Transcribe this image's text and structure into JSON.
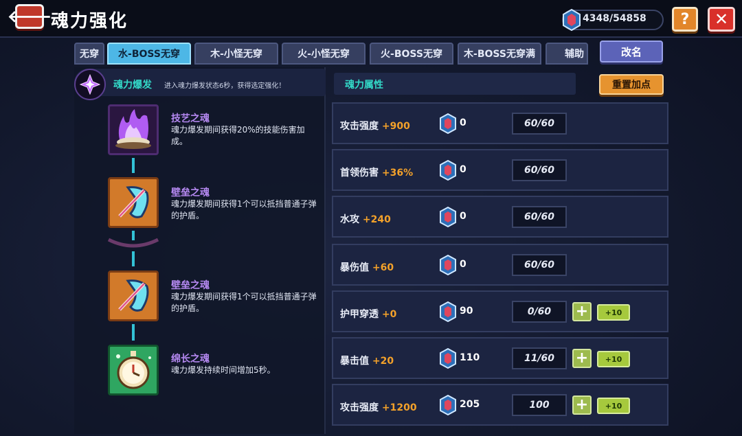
{
  "header": {
    "title": "魂力强化",
    "back_label": "🡐",
    "currency": "4348/54858",
    "help_label": "?",
    "close_label": "✕"
  },
  "tabs": [
    {
      "label": "无穿"
    },
    {
      "label": "水-BOSS无穿",
      "active": true
    },
    {
      "label": "木-小怪无穿"
    },
    {
      "label": "火-小怪无穿"
    },
    {
      "label": "火-BOSS无穿"
    },
    {
      "label": "木-BOSS无穿满"
    },
    {
      "label": "辅助"
    }
  ],
  "rename_label": "改名",
  "burst": {
    "title": "魂力爆发",
    "description": "进入魂力爆发状态6秒，获得选定强化！"
  },
  "souls": [
    {
      "name": "技艺之魂",
      "description": "魂力爆发期间获得20%的技能伤害加成。",
      "icon": "purple-flame-icon"
    },
    {
      "name": "壁垒之魂",
      "description": "魂力爆发期间获得1个可以抵挡普通子弹的护盾。",
      "icon": "shield-icon"
    },
    {
      "name": "壁垒之魂",
      "description": "魂力爆发期间获得1个可以抵挡普通子弹的护盾。",
      "icon": "shield-icon"
    },
    {
      "name": "绵长之魂",
      "description": "魂力爆发持续时间增加5秒。",
      "icon": "stopwatch-icon"
    }
  ],
  "attributes": {
    "title": "魂力属性",
    "reset_label": "重置加点",
    "plus_label": "+",
    "plus10_label": "+10",
    "rows": [
      {
        "label": "攻击强度",
        "bonus": "+900",
        "cost": "0",
        "level": "60/60",
        "can_add": false
      },
      {
        "label": "首领伤害",
        "bonus": "+36%",
        "cost": "0",
        "level": "60/60",
        "can_add": false
      },
      {
        "label": "水攻",
        "bonus": "+240",
        "cost": "0",
        "level": "60/60",
        "can_add": false
      },
      {
        "label": "暴伤值",
        "bonus": "+60",
        "cost": "0",
        "level": "60/60",
        "can_add": false
      },
      {
        "label": "护甲穿透",
        "bonus": "+0",
        "cost": "90",
        "level": "0/60",
        "can_add": true
      },
      {
        "label": "暴击值",
        "bonus": "+20",
        "cost": "110",
        "level": "11/60",
        "can_add": true
      },
      {
        "label": "攻击强度",
        "bonus": "+1200",
        "cost": "205",
        "level": "100",
        "can_add": true
      }
    ]
  },
  "colors": {
    "accent_cyan": "#33d9c8",
    "bonus_orange": "#f3a12a",
    "active_tab": "#4db7e6"
  }
}
